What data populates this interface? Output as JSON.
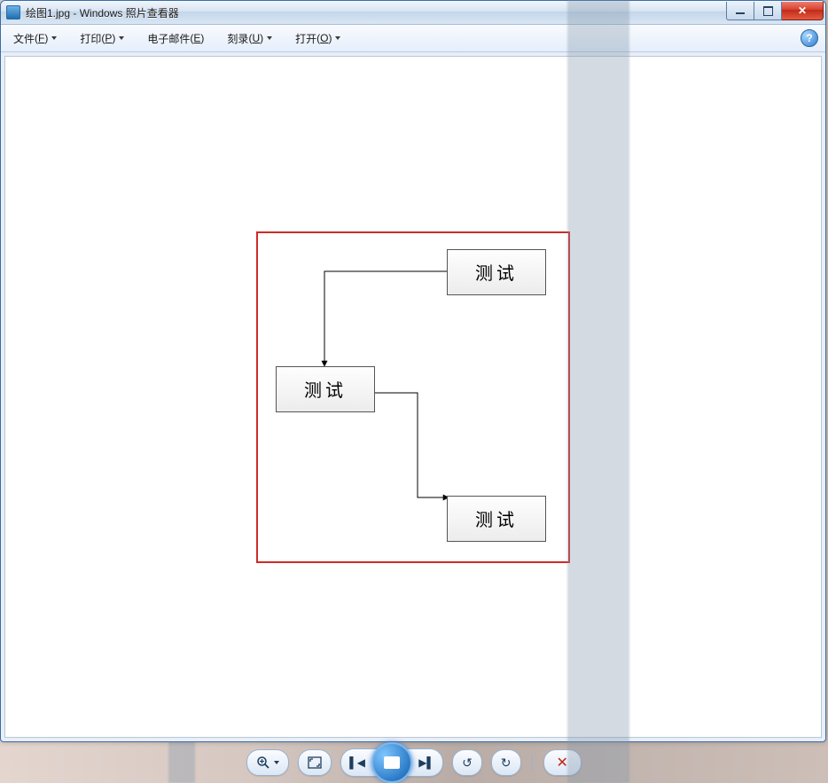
{
  "titlebar": {
    "filename": "绘图1.jpg",
    "appname": "Windows 照片查看器"
  },
  "menu": {
    "file": {
      "text": "文件",
      "hotkey": "F"
    },
    "print": {
      "text": "打印",
      "hotkey": "P"
    },
    "email": {
      "text": "电子邮件",
      "hotkey": "E"
    },
    "burn": {
      "text": "刻录",
      "hotkey": "U"
    },
    "open": {
      "text": "打开",
      "hotkey": "O"
    },
    "help": "?"
  },
  "diagram": {
    "node1": "测试",
    "node2": "测试",
    "node3": "测试"
  },
  "controls": {
    "zoom_tip": "更改显示大小",
    "fit_tip": "实际大小",
    "prev_tip": "上一个",
    "next_tip": "下一个",
    "slideshow_tip": "播放幻灯片",
    "rotate_ccw_tip": "逆时针旋转",
    "rotate_cw_tip": "顺时针旋转",
    "delete_tip": "删除",
    "delete_glyph": "✕",
    "ccw_glyph": "↺",
    "cw_glyph": "↻",
    "prev_glyph": "▌◀",
    "next_glyph": "▶▌"
  }
}
